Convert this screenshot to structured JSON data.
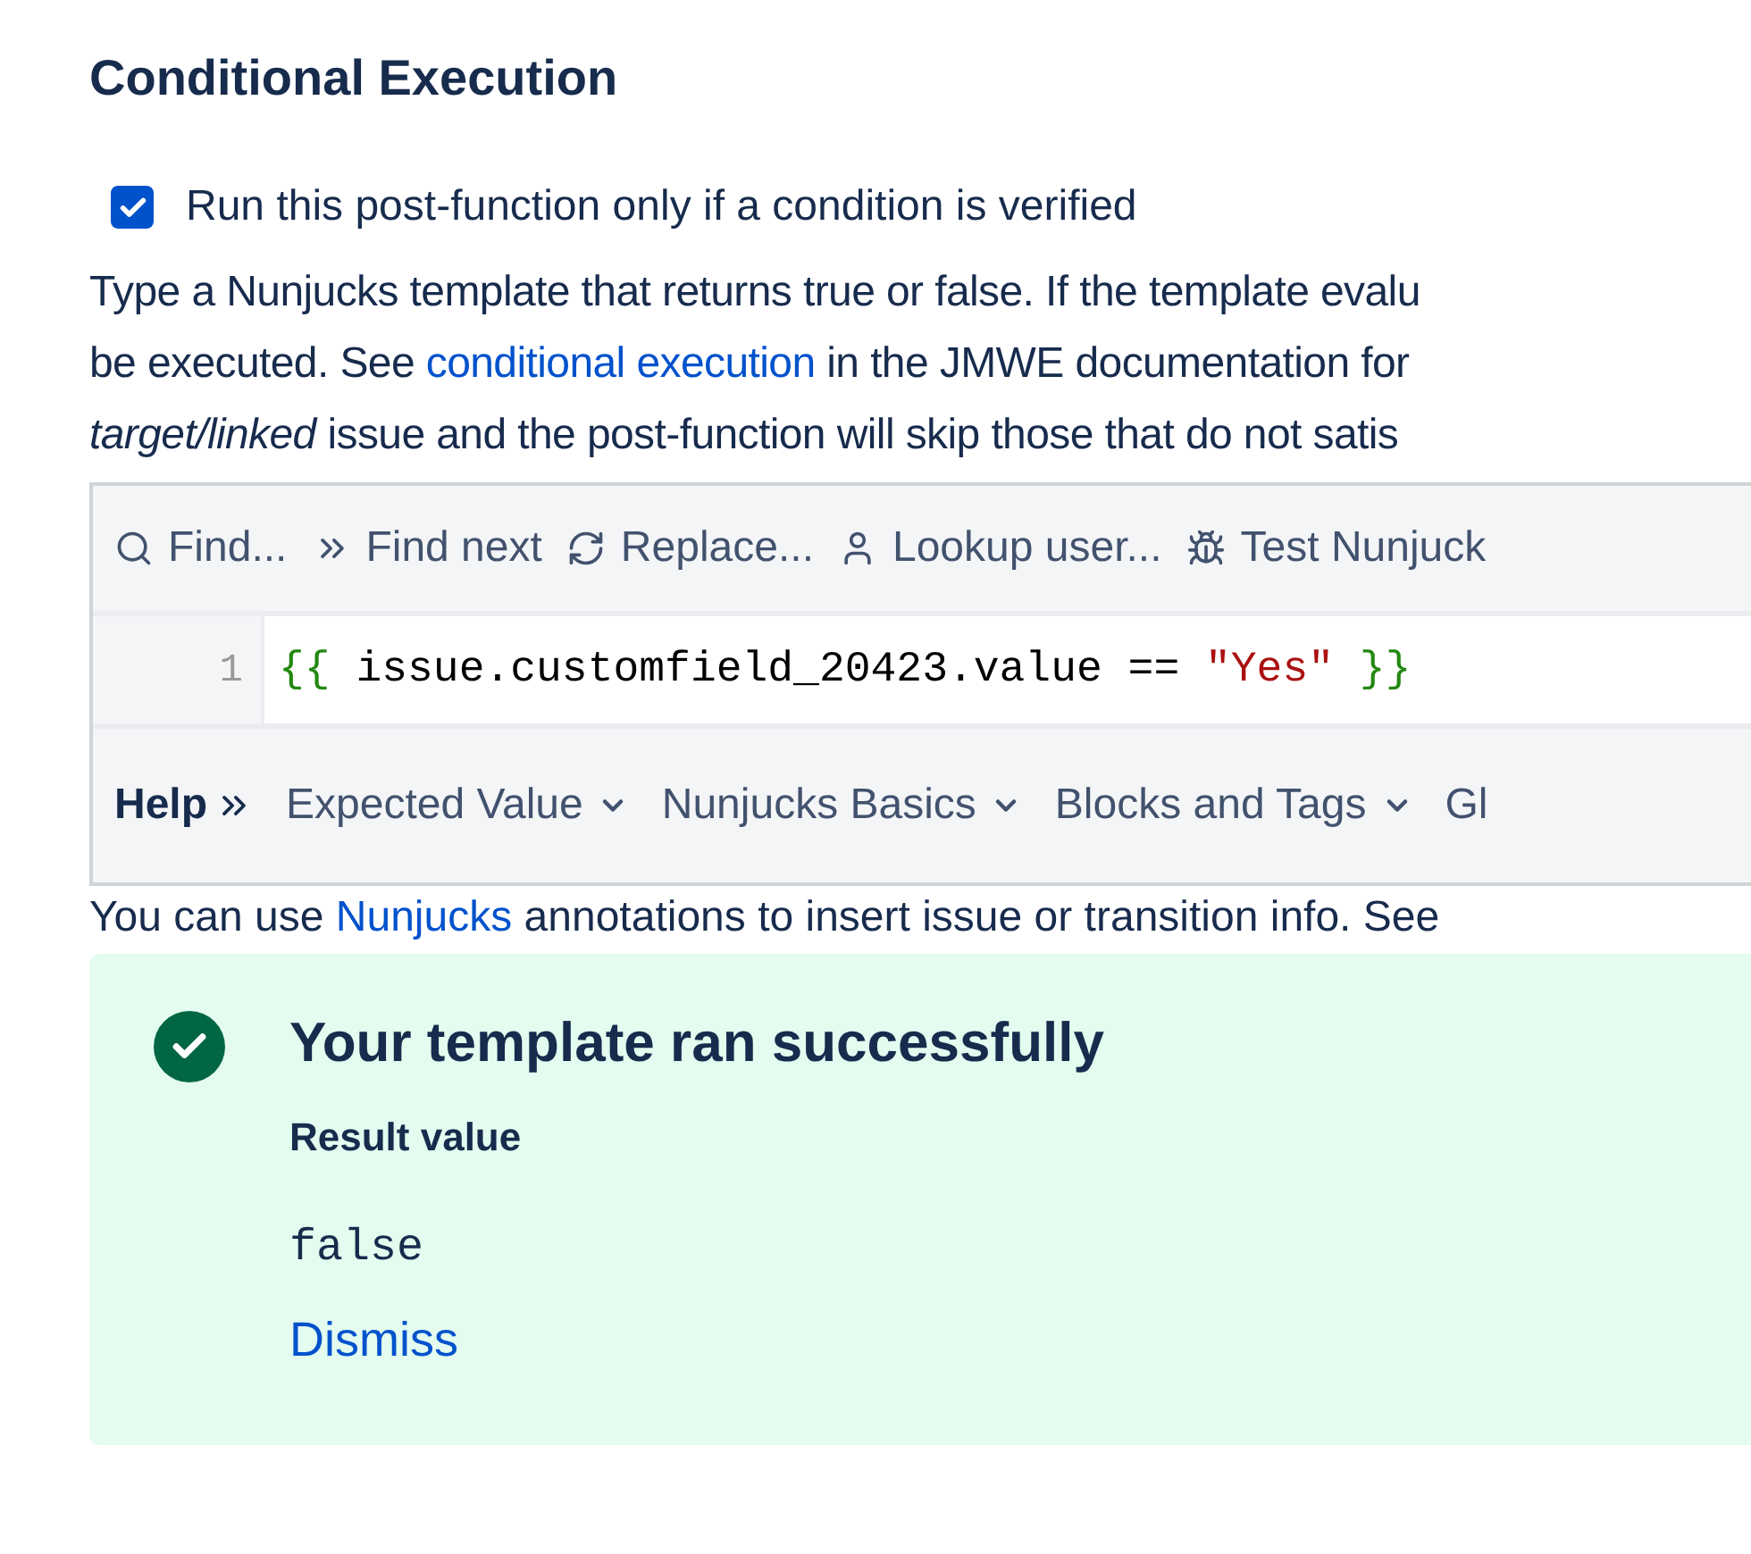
{
  "section_title": "Conditional Execution",
  "condition_checkbox": {
    "label": "Run this post-function only if a condition is verified",
    "checked": true
  },
  "description": {
    "lines": [
      {
        "text": "Type a Nunjucks template that returns true or false. If the template evalu"
      },
      {
        "text": "be executed. See ",
        "link": "conditional execution",
        "after": " in the JMWE documentation for"
      },
      {
        "text": "*target/linked* issue and the post-function will skip those that do not satis"
      }
    ]
  },
  "editor": {
    "toolbar": [
      {
        "kind": "search",
        "label": "Find..."
      },
      {
        "kind": "next",
        "label": "Find next"
      },
      {
        "kind": "replace",
        "label": "Replace..."
      },
      {
        "kind": "user",
        "label": "Lookup user..."
      },
      {
        "kind": "bug",
        "label": "Test Nunjuck"
      }
    ],
    "lines": [
      {
        "number": "1",
        "tokens": [
          {
            "color": "#228811",
            "text": "{{"
          },
          {
            "color": "#000000",
            "text": " issue.customfield_20423.value == "
          },
          {
            "color": "#aa1111",
            "text": "\"Yes\""
          },
          {
            "color": "#228811",
            "text": " }}"
          }
        ]
      }
    ],
    "help": {
      "label": "Help",
      "menus": [
        "Expected Value",
        "Nunjucks Basics",
        "Blocks and Tags",
        "Gl"
      ]
    }
  },
  "hint": {
    "before": "You can use ",
    "link": "Nunjucks",
    "after": " annotations to insert issue or transition info. See"
  },
  "result": {
    "title": "Your template ran successfully",
    "label": "Result value",
    "value": "false",
    "dismiss": "Dismiss"
  }
}
